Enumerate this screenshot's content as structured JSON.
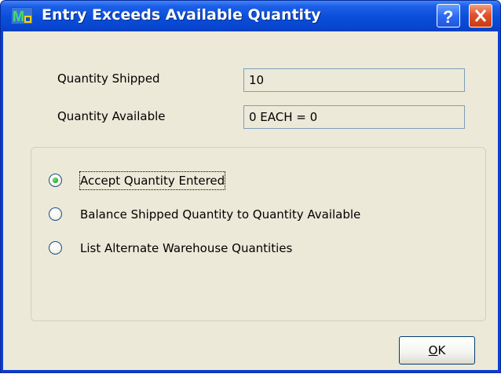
{
  "window": {
    "title": "Entry Exceeds Available Quantity",
    "help_icon": "question-mark-icon",
    "close_icon": "close-x-icon",
    "app_icon": "app-logo-icon"
  },
  "fields": {
    "quantity_shipped_label": "Quantity Shipped",
    "quantity_shipped_value": "10",
    "quantity_available_label": "Quantity Available",
    "quantity_available_value": "0 EACH = 0"
  },
  "options": [
    {
      "label": "Accept Quantity Entered",
      "selected": true
    },
    {
      "label": "Balance Shipped Quantity to Quantity Available",
      "selected": false
    },
    {
      "label": "List Alternate Warehouse Quantities",
      "selected": false
    }
  ],
  "buttons": {
    "ok_mnemonic": "O",
    "ok_rest": "K"
  },
  "colors": {
    "titlebar": "#0a4ed8",
    "client": "#ece9d8",
    "close_button": "#e2532b",
    "radio_dot": "#2ba52b"
  }
}
